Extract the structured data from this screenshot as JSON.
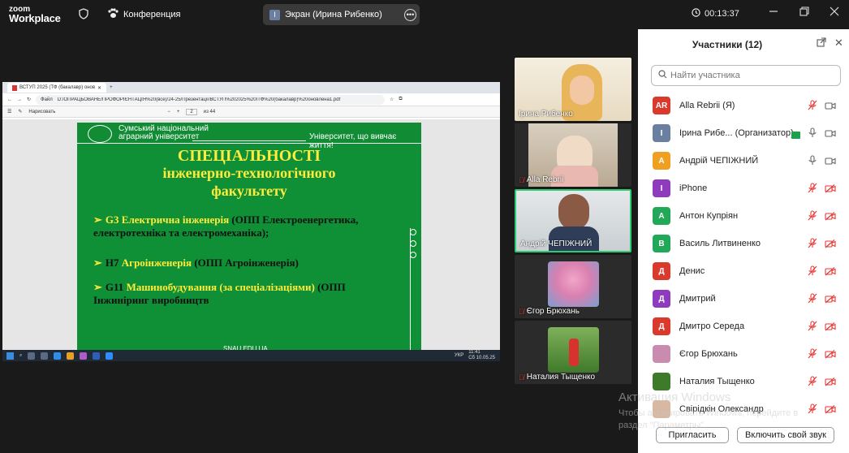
{
  "app": {
    "logo_top": "zoom",
    "logo_bottom": "Workplace"
  },
  "header": {
    "conference_label": "Конференция",
    "screen_share_label": "Экран (Ирина Рибенко)",
    "screen_share_initial": "I",
    "timer": "00:13:37"
  },
  "shared_screen": {
    "browser": {
      "tab_title": "ВСТУП 2025 (ТФ (бакалавр) онов",
      "url_prefix": "Файл",
      "url": "D:/ОПРАЦЬОВАНЕ/ПРОФОРІЄНТАЦІЯ%20(все)/24-25/Презентації/ВСТУП%202025%20ІТФ%20(бакалавр)%20оновлена1.pdf",
      "draw_label": "Нарисовать",
      "page_current": "2",
      "page_total": "из 44"
    },
    "slide": {
      "uni_line1": "Сумський національний",
      "uni_line2": "аграрний університет",
      "motto": "Університет, що вивчає життя!",
      "title_line1": "СПЕЦІАЛЬНОСТІ",
      "title_line2": "інженерно-технологічного",
      "title_line3": "факультету",
      "items": [
        {
          "code": "G3",
          "name": "Електрична інженерія",
          "detail": "(ОПП Електроенергетика, електротехніка та електромеханіка);"
        },
        {
          "code": "H7",
          "name": "Агроінженерія",
          "detail": "(ОПП Агроінженерія)"
        },
        {
          "code": "G11",
          "name": "Машинобудування (за спеціалізаціями)",
          "detail": "(ОПП Інжиніринг виробництв"
        }
      ],
      "footer": "SNAU.EDU.UA"
    },
    "taskbar": {
      "lang": "УКР",
      "time": "11:41",
      "date": "Сб 10.05.25"
    }
  },
  "video_tiles": [
    {
      "name": "Ірина Рибенко",
      "muted": false
    },
    {
      "name": "Alla Rebrii",
      "muted": true
    },
    {
      "name": "Андрій ЧЕПІЖНИЙ",
      "muted": false
    },
    {
      "name": "Єгор Брюхань",
      "muted": true
    },
    {
      "name": "Наталия Тыщенко",
      "muted": true
    }
  ],
  "participants_panel": {
    "title": "Участники (12)",
    "search_placeholder": "Найти участника",
    "participants": [
      {
        "initials": "AR",
        "name": "Alla Rebrii (Я)",
        "color": "#d93a2b"
      },
      {
        "initials": "I",
        "name": "Ірина Рибе... (Организатор)",
        "color": "#6b7fa0"
      },
      {
        "initials": "А",
        "name": "Андрій ЧЕПІЖНИЙ",
        "color": "#f0a020"
      },
      {
        "initials": "I",
        "name": "iPhone",
        "color": "#8e3bbd"
      },
      {
        "initials": "А",
        "name": "Антон Купріян",
        "color": "#22a859"
      },
      {
        "initials": "В",
        "name": "Василь Литвиненко",
        "color": "#22a859"
      },
      {
        "initials": "Д",
        "name": "Денис",
        "color": "#d93a2b"
      },
      {
        "initials": "Д",
        "name": "Дмитрий",
        "color": "#8e3bbd"
      },
      {
        "initials": "Д",
        "name": "Дмитро Середа",
        "color": "#d93a2b"
      },
      {
        "initials": "",
        "name": "Єгор Брюхань",
        "color": "#c98bb0"
      },
      {
        "initials": "",
        "name": "Наталия Тыщенко",
        "color": "#3d7a2a"
      },
      {
        "initials": "",
        "name": "Свірідкін Олександр",
        "color": "#d8b8a0"
      }
    ],
    "invite_label": "Пригласить",
    "unmute_label": "Включить свой звук"
  },
  "watermark": {
    "line1": "Активация Windows",
    "line2": "Чтобы активировать Windows, перейдите в",
    "line3": "раздел \"Параметры\"."
  }
}
